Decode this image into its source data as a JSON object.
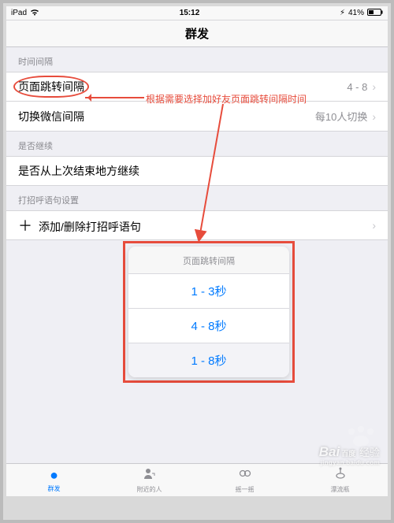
{
  "status": {
    "carrier": "iPad",
    "time": "15:12",
    "battery": "41%"
  },
  "nav": {
    "title": "群发"
  },
  "sections": {
    "interval": {
      "header": "时间间隔",
      "row1": {
        "label": "页面跳转间隔",
        "value": "4 - 8"
      },
      "row2": {
        "label": "切换微信间隔",
        "value": "每10人切换"
      }
    },
    "resume": {
      "header": "是否继续",
      "row": {
        "label": "是否从上次结束地方继续"
      }
    },
    "greeting": {
      "header": "打招呼语句设置",
      "row": {
        "label": "添加/删除打招呼语句"
      }
    }
  },
  "annotation": {
    "text": "根据需要选择加好友页面跳转间隔时间"
  },
  "popup": {
    "title": "页面跳转间隔",
    "options": [
      "1 - 3秒",
      "4 - 8秒",
      "1 - 8秒"
    ]
  },
  "tabs": {
    "t1": "群发",
    "t2": "附近的人",
    "t3": "摇一摇",
    "t4": "漂流瓶"
  },
  "watermark": {
    "brand": "Bai",
    "brand2": "百度",
    "sub": "经验",
    "url": "jingyan.baidu.com"
  }
}
